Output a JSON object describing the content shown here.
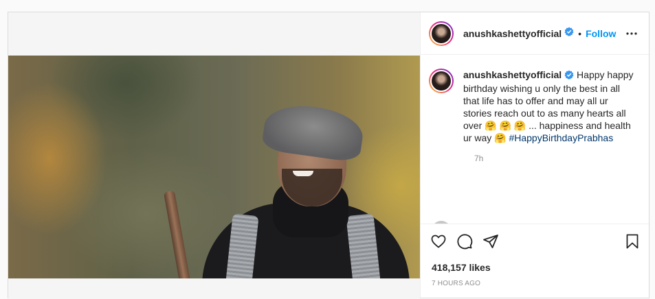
{
  "post": {
    "author": "anushkashettyofficial",
    "follow_label": "Follow",
    "separator": "•",
    "caption_text": "Happy happy birthday wishing u only the best in all that life has to offer and may all ur stories reach out to as many hearts all over 🤗 🤗 🤗 ... happiness and health ur way 🤗",
    "hashtag": "#HappyBirthdayPrabhas",
    "caption_time": "7h",
    "likes": "418,157 likes",
    "posted_ago": "7 HOURS AGO"
  },
  "icons": {
    "verified": "verified-badge-icon",
    "more": "more-options-icon",
    "like": "heart-icon",
    "comment": "comment-icon",
    "share": "paper-plane-icon",
    "save": "bookmark-icon",
    "tagged": "tagged-user-icon"
  },
  "colors": {
    "accent": "#0095f6",
    "verified": "#3897f0",
    "hashtag": "#00376b",
    "text": "#262626",
    "muted": "#8e8e8e"
  }
}
